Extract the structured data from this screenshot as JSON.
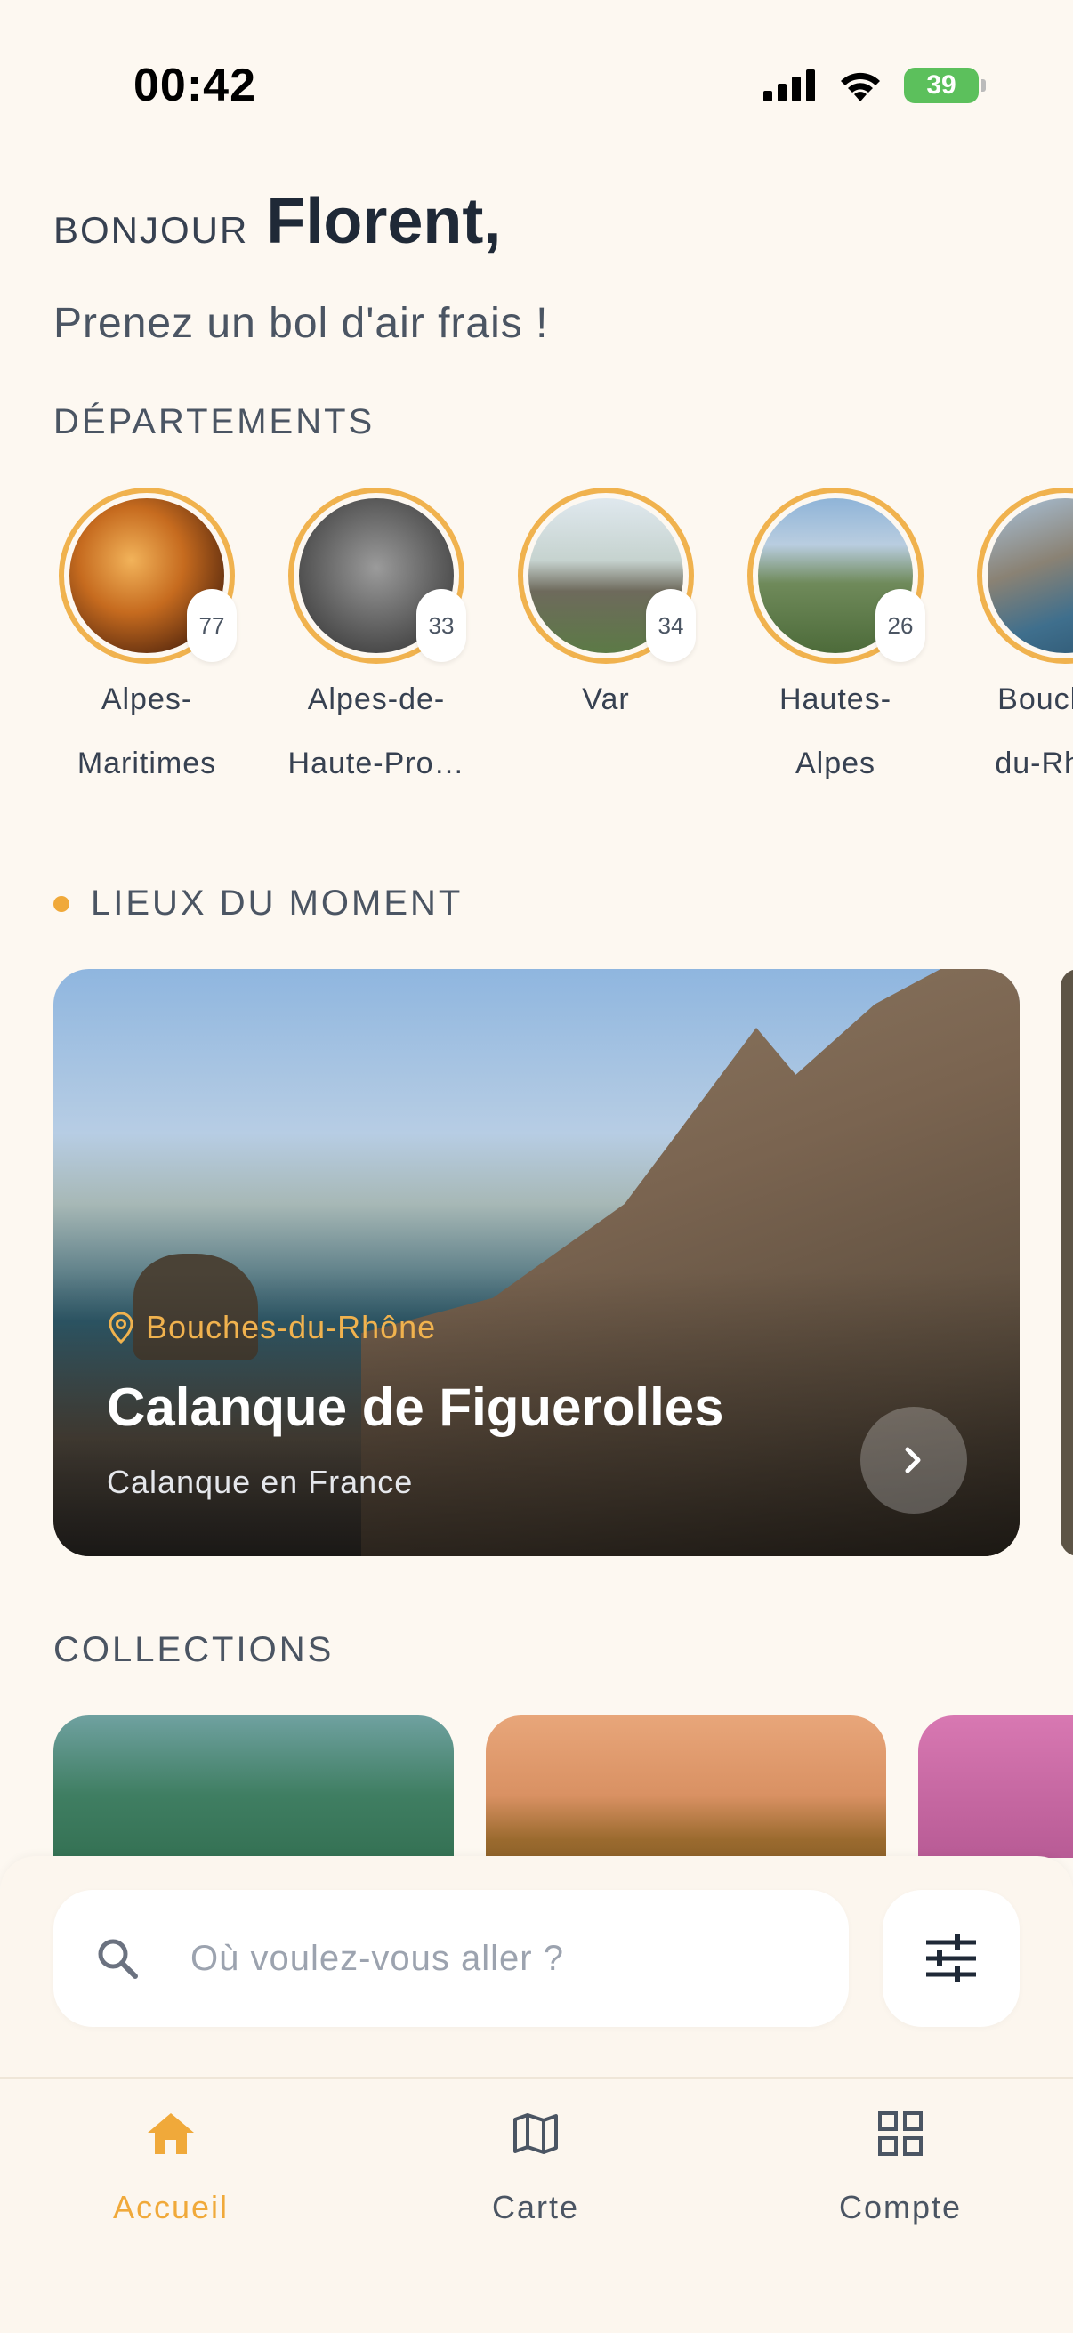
{
  "status_bar": {
    "time": "00:42",
    "battery": "39"
  },
  "greeting": {
    "small": "BONJOUR",
    "name": "Florent,",
    "tagline": "Prenez un bol d'air frais !"
  },
  "departments": {
    "title": "DÉPARTEMENTS",
    "items": [
      {
        "line1": "Alpes-",
        "line2": "Maritimes",
        "count": "77"
      },
      {
        "line1": "Alpes-de-",
        "line2": "Haute-Pro…",
        "count": "33"
      },
      {
        "line1": "Var",
        "line2": "",
        "count": "34"
      },
      {
        "line1": "Hautes-",
        "line2": "Alpes",
        "count": "26"
      },
      {
        "line1": "Bouches-",
        "line2": "du-Rhône",
        "count": ""
      }
    ]
  },
  "featured": {
    "title": "LIEUX DU MOMENT",
    "card": {
      "location": "Bouches-du-Rhône",
      "name": "Calanque de Figuerolles",
      "subtitle": "Calanque en France"
    }
  },
  "collections": {
    "title": "COLLECTIONS"
  },
  "search": {
    "placeholder": "Où voulez-vous aller ?"
  },
  "nav": {
    "items": [
      {
        "label": "Accueil",
        "icon": "home-icon",
        "active": true
      },
      {
        "label": "Carte",
        "icon": "map-icon",
        "active": false
      },
      {
        "label": "Compte",
        "icon": "grid-icon",
        "active": false
      }
    ]
  },
  "colors": {
    "accent": "#f0a93a",
    "background": "#fdf8f1",
    "text": "#1f2937"
  }
}
